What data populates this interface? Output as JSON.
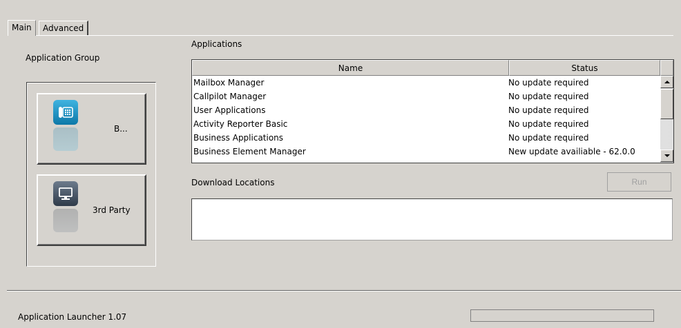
{
  "tabs": [
    {
      "label": "Main",
      "active": true
    },
    {
      "label": "Advanced",
      "active": false
    }
  ],
  "application_group": {
    "label": "Application Group",
    "buttons": [
      {
        "label": "B...",
        "icon": "phone-icon"
      },
      {
        "label": "3rd Party",
        "icon": "computer-icon"
      }
    ]
  },
  "applications": {
    "label": "Applications",
    "columns": [
      "Name",
      "Status"
    ],
    "rows": [
      {
        "name": "Mailbox Manager",
        "status": "No update required"
      },
      {
        "name": "Callpilot Manager",
        "status": "No update required"
      },
      {
        "name": "User Applications",
        "status": "No update required"
      },
      {
        "name": "Activity Reporter Basic",
        "status": "No update required"
      },
      {
        "name": "Business Applications",
        "status": "No update required"
      },
      {
        "name": "Business Element Manager",
        "status": "New update availiable - 62.0.0"
      }
    ]
  },
  "download": {
    "label": "Download Locations",
    "run_label": "Run"
  },
  "status_bar": {
    "text": "Application Launcher 1.07",
    "progress": 0
  },
  "colors": {
    "background": "#d6d3ce",
    "phone_icon": "#1a8fc4",
    "computer_icon": "#3a4756"
  }
}
